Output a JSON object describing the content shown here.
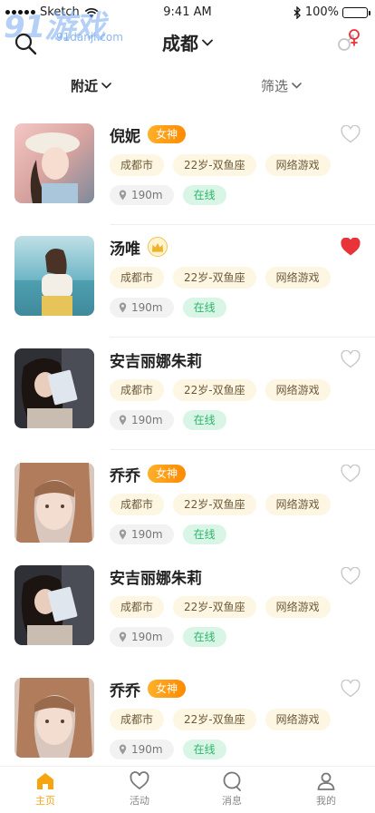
{
  "status_bar": {
    "carrier": "Sketch",
    "time": "9:41 AM",
    "battery": "100%"
  },
  "watermark": {
    "big": "91游戏",
    "small": "91danji.com"
  },
  "header": {
    "city": "成都"
  },
  "filter_bar": {
    "nearby": "附近",
    "screen": "筛选"
  },
  "profiles": [
    {
      "name": "倪妮",
      "badge": "女神",
      "badge_type": "goddess",
      "tags": [
        "成都市",
        "22岁-双鱼座",
        "网络游戏"
      ],
      "distance": "190m",
      "status": "在线",
      "liked": false
    },
    {
      "name": "汤唯",
      "badge": "",
      "badge_type": "crown",
      "tags": [
        "成都市",
        "22岁-双鱼座",
        "网络游戏"
      ],
      "distance": "190m",
      "status": "在线",
      "liked": true
    },
    {
      "name": "安吉丽娜朱莉",
      "badge": "",
      "badge_type": "none",
      "tags": [
        "成都市",
        "22岁-双鱼座",
        "网络游戏"
      ],
      "distance": "190m",
      "status": "在线",
      "liked": false
    },
    {
      "name": "乔乔",
      "badge": "女神",
      "badge_type": "goddess",
      "tags": [
        "成都市",
        "22岁-双鱼座",
        "网络游戏"
      ],
      "distance": "190m",
      "status": "在线",
      "liked": false
    },
    {
      "name": "安吉丽娜朱莉",
      "badge": "",
      "badge_type": "none",
      "tags": [
        "成都市",
        "22岁-双鱼座",
        "网络游戏"
      ],
      "distance": "190m",
      "status": "在线",
      "liked": false
    },
    {
      "name": "乔乔",
      "badge": "女神",
      "badge_type": "goddess",
      "tags": [
        "成都市",
        "22岁-双鱼座",
        "网络游戏"
      ],
      "distance": "190m",
      "status": "在线",
      "liked": false
    }
  ],
  "tabbar": {
    "home": "主页",
    "activity": "活动",
    "messages": "消息",
    "mine": "我的"
  },
  "colors": {
    "accent": "#f7a411",
    "heart_active": "#e8333a",
    "online": "#2fb56d"
  }
}
